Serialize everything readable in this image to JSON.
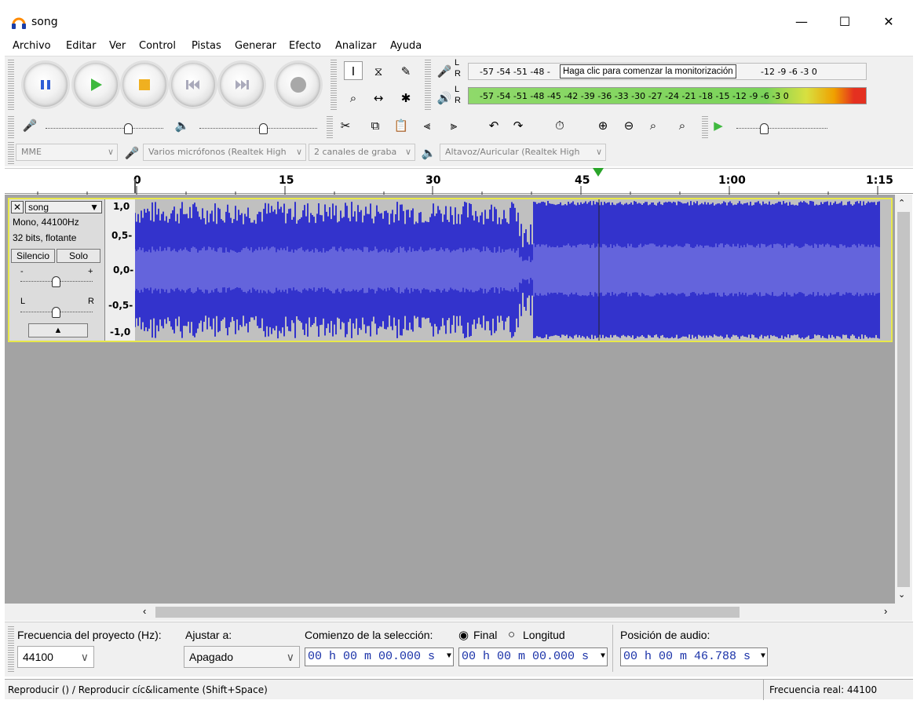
{
  "window": {
    "title": "song",
    "minimize": "—",
    "maximize": "☐",
    "close": "✕"
  },
  "menu": [
    "Archivo",
    "Editar",
    "Ver",
    "Control",
    "Pistas",
    "Generar",
    "Efecto",
    "Analizar",
    "Ayuda"
  ],
  "meters": {
    "record_scale": "-57 -54 -51 -48 -",
    "record_scale_tail": "-12 -9 -6 -3 0",
    "record_tooltip": "Haga clic para comenzar la monitorización",
    "play_scale": "-57 -54 -51 -48 -45 -42 -39 -36 -33 -30 -27 -24 -21 -18 -15 -12 -9 -6 -3 0",
    "lr_l": "L",
    "lr_r": "R"
  },
  "device": {
    "host": "MME",
    "mic": "Varios micrófonos (Realtek High",
    "channels": "2 canales de graba",
    "speaker": "Altavoz/Auricular (Realtek High"
  },
  "ruler": {
    "ticks": [
      "0",
      "15",
      "30",
      "45",
      "1:00",
      "1:15"
    ]
  },
  "track": {
    "name": "song",
    "format": "Mono, 44100Hz",
    "bits": "32 bits, flotante",
    "mute": "Silencio",
    "solo": "Solo",
    "gain_minus": "-",
    "gain_plus": "+",
    "pan_l": "L",
    "pan_r": "R",
    "collapse": "▲",
    "scale": [
      "1,0",
      "0,5-",
      "0,0-",
      "-0,5-",
      "-1,0"
    ]
  },
  "selection": {
    "rate_label": "Frecuencia del proyecto (Hz):",
    "rate_value": "44100",
    "snap_label": "Ajustar a:",
    "snap_value": "Apagado",
    "start_label": "Comienzo de la selección:",
    "end_option": "Final",
    "length_option": "Longitud",
    "start_time": "00 h 00 m 00.000 s",
    "end_time": "00 h 00 m 00.000 s",
    "position_label": "Posición de audio:",
    "position_time": "00 h 00 m 46.788 s"
  },
  "status": {
    "left": "Reproducir () / Reproducir cíc&licamente (Shift+Space)",
    "right": "Frecuencia real: 44100"
  },
  "colors": {
    "waveform": "#3333cc",
    "waveform_rms": "#6464dc",
    "selection_border": "#e8e84a",
    "play_green": "#3fb93f",
    "record_red": "#c0c0c0"
  }
}
